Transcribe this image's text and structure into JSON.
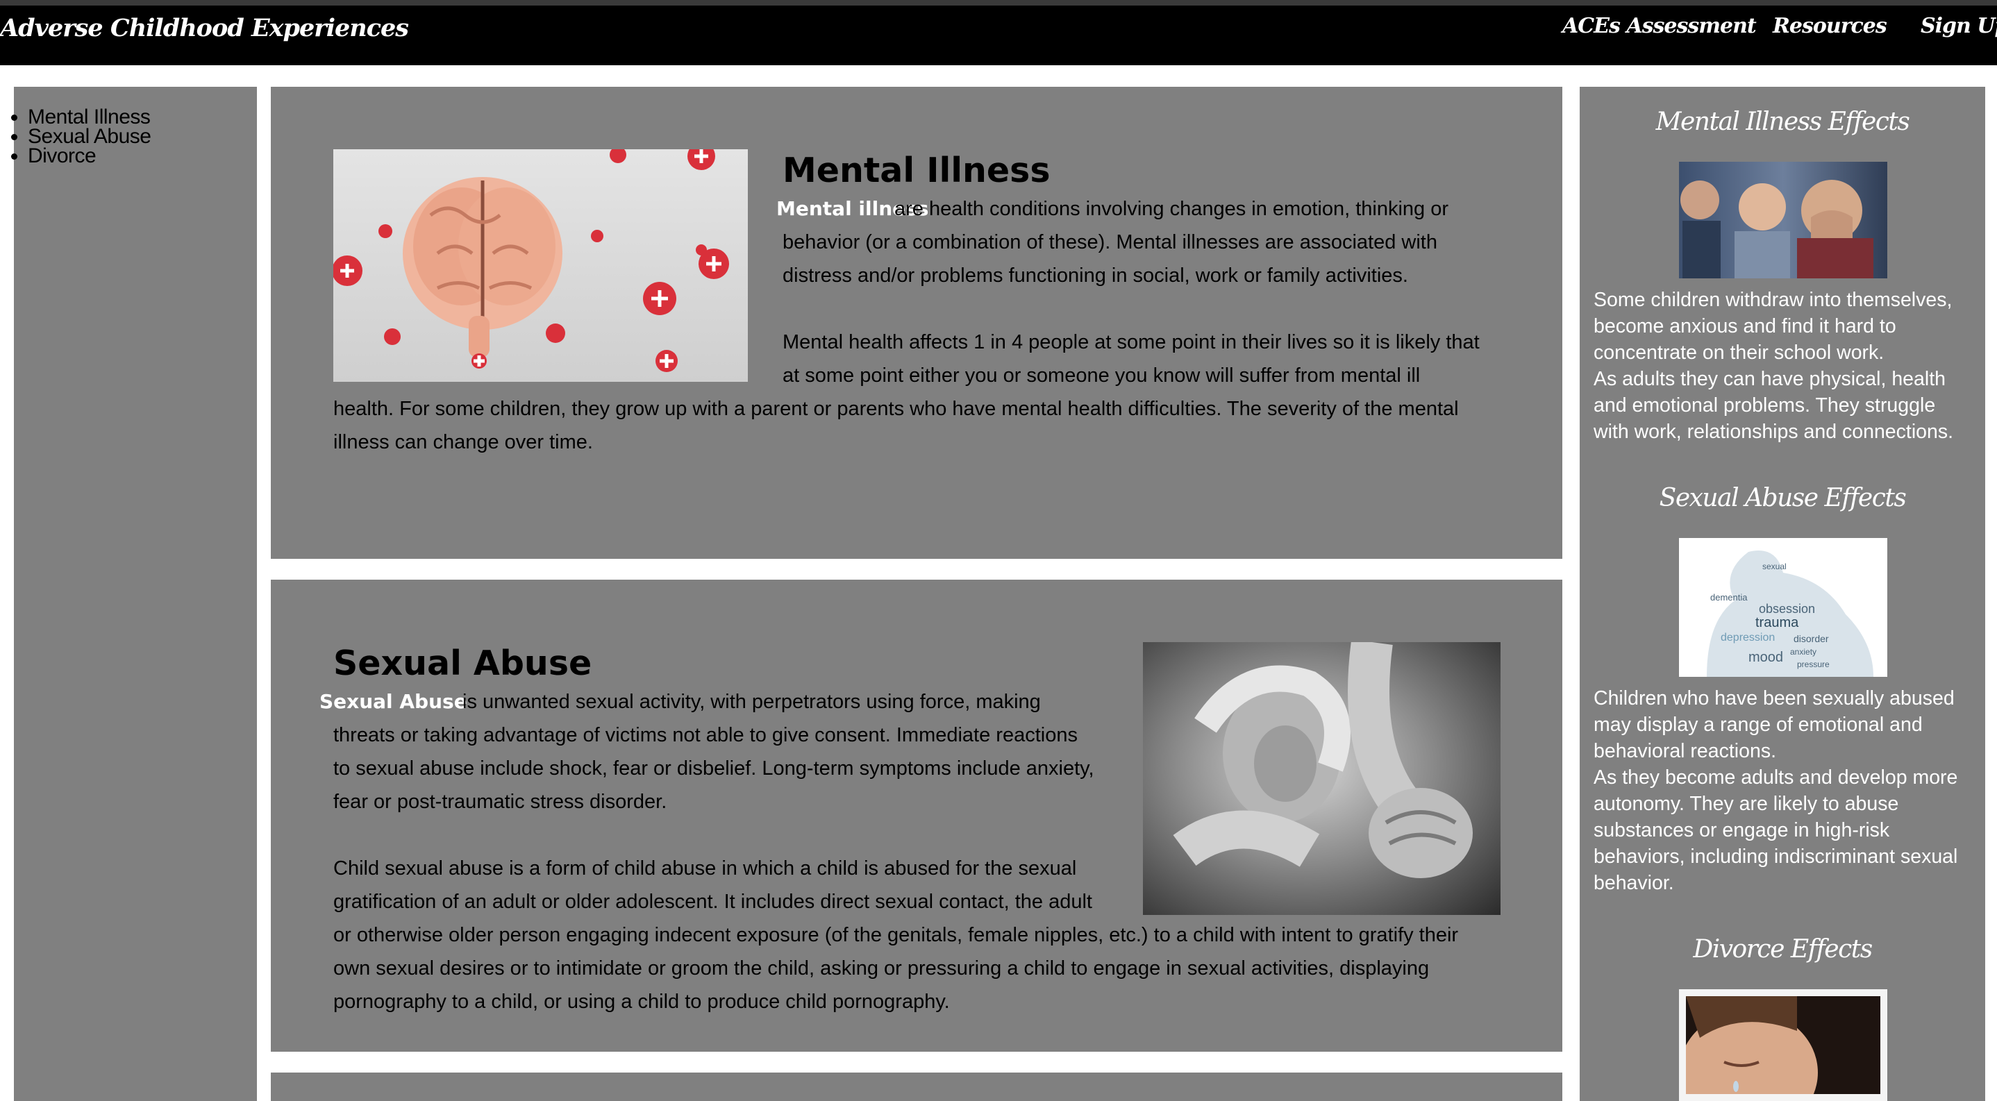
{
  "header": {
    "brand": "Adverse Childhood Experiences",
    "nav": [
      "ACEs Assessment",
      "Resources",
      "Sign Up"
    ]
  },
  "sidebar": {
    "items": [
      "Mental Illness",
      "Sexual Abuse",
      "Divorce"
    ]
  },
  "sections": {
    "mental_illness": {
      "title": "Mental Illness",
      "lead": "Mental illness",
      "para1": [
        "are health conditions involving changes in emotion, thinking or",
        "behavior (or a combination of these). Mental illnesses are associated with",
        "distress and/or problems functioning in social, work or family activities."
      ],
      "para2": [
        "Mental health affects 1 in 4 people at some point in their lives so it is likely that",
        "at some point either you or someone you know will suffer from mental ill",
        "health. For some children, they grow up with a parent or parents who have mental health difficulties. The severity of the mental",
        "illness can change over time."
      ]
    },
    "sexual_abuse": {
      "title": "Sexual Abuse",
      "lead": "Sexual Abuse",
      "para1": [
        "is unwanted sexual activity, with perpetrators using force, making",
        "threats or taking advantage of victims not able to give consent. Immediate reactions",
        "to sexual abuse include shock, fear or disbelief. Long-term symptoms include anxiety,",
        "fear or post-traumatic stress disorder."
      ],
      "para2": [
        "Child sexual abuse is a form of child abuse in which a child is abused for the sexual",
        "gratification of an adult or older adolescent. It includes direct sexual contact, the adult",
        "or otherwise older person engaging indecent exposure (of the genitals, female nipples, etc.) to a child with intent to gratify their",
        "own sexual desires or to intimidate or groom the child, asking or pressuring a child to engage in sexual activities, displaying",
        "pornography to a child, or using a child to produce child pornography."
      ]
    }
  },
  "effects": {
    "mental_illness": {
      "title": "Mental Illness Effects",
      "lines": [
        "Some children withdraw into themselves,",
        "become anxious and find it hard to",
        "concentrate on their school work.",
        "As adults they can have physical, health",
        "and emotional problems. They struggle",
        "with work, relationships and connections."
      ]
    },
    "sexual_abuse": {
      "title": "Sexual Abuse Effects",
      "wordcloud": [
        "obsession",
        "trauma",
        "depression",
        "mood",
        "dementia",
        "sexual",
        "disorder",
        "anxiety",
        "pressure"
      ],
      "lines": [
        "Children who have been sexually abused",
        "may display a range of emotional and",
        "behavioral reactions.",
        "As they become adults and develop more",
        "autonomy. They are likely to abuse",
        "substances or engage in high-risk",
        "behaviors, including indiscriminant sexual",
        "behavior."
      ]
    },
    "divorce": {
      "title": "Divorce Effects"
    }
  },
  "colors": {
    "navbar": "#000000",
    "panel": "#808080",
    "accent_text": "#ffffff"
  }
}
